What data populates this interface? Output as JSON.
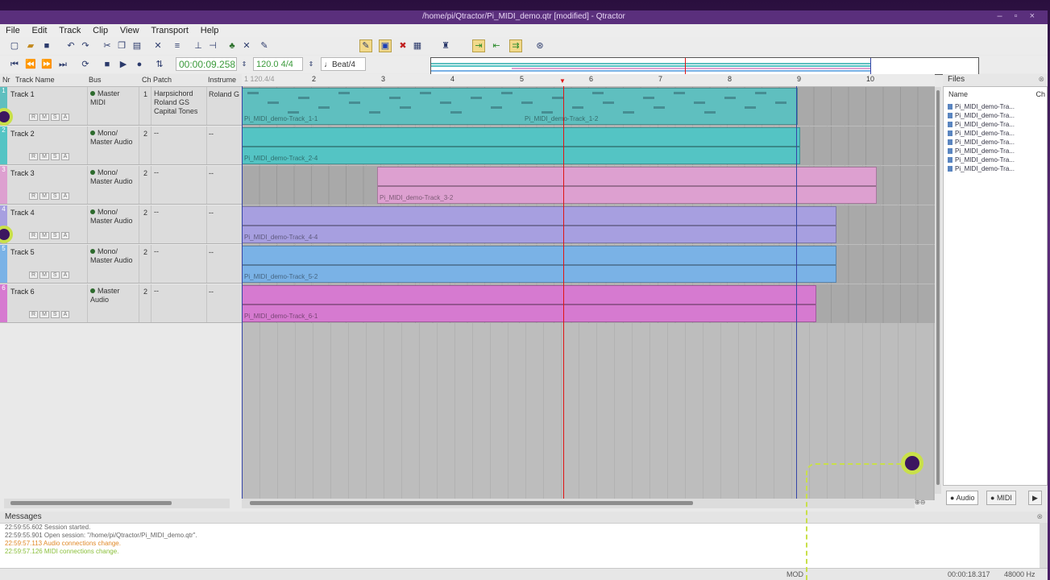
{
  "window": {
    "title": "/home/pi/Qtractor/Pi_MIDI_demo.qtr [modified] - Qtractor",
    "controls": "– ▫ ×"
  },
  "menu": [
    "File",
    "Edit",
    "Track",
    "Clip",
    "View",
    "Transport",
    "Help"
  ],
  "transport": {
    "time": "00:00:09.258",
    "tempo": "120.0 4/4",
    "snap": "♩Beat/4"
  },
  "track_headers": {
    "nr": "Nr",
    "name": "Track Name",
    "bus": "Bus",
    "ch": "Ch",
    "patch": "Patch",
    "instrument": "Instrume"
  },
  "tracks": [
    {
      "nr": "1",
      "name": "Track 1",
      "bus": "Master MIDI",
      "ch": "1",
      "patch": "Harpsichord Roland GS Capital Tones",
      "inst": "Roland G",
      "color": "#5fbfbf"
    },
    {
      "nr": "2",
      "name": "Track 2",
      "bus": "Mono/ Master Audio",
      "ch": "2",
      "patch": "--",
      "inst": "--",
      "color": "#54c4c4"
    },
    {
      "nr": "3",
      "name": "Track 3",
      "bus": "Mono/ Master Audio",
      "ch": "2",
      "patch": "--",
      "inst": "--",
      "color": "#dda0d0"
    },
    {
      "nr": "4",
      "name": "Track 4",
      "bus": "Mono/ Master Audio",
      "ch": "2",
      "patch": "--",
      "inst": "--",
      "color": "#a79fe0"
    },
    {
      "nr": "5",
      "name": "Track 5",
      "bus": "Mono/ Master Audio",
      "ch": "2",
      "patch": "--",
      "inst": "--",
      "color": "#7ab2e6"
    },
    {
      "nr": "6",
      "name": "Track 6",
      "bus": "Master Audio",
      "ch": "2",
      "patch": "--",
      "inst": "--",
      "color": "#d67ad0"
    }
  ],
  "track_buttons": [
    "R",
    "M",
    "S",
    "A"
  ],
  "ruler": {
    "start": "1 120.4/4",
    "marks": [
      "2",
      "3",
      "4",
      "5",
      "6",
      "7",
      "8",
      "9",
      "10"
    ]
  },
  "clips": [
    {
      "label": "Pi_MIDI_demo-Track_1-1",
      "label2": "Pi_MIDI_demo-Track_1-2"
    },
    {
      "label": "Pi_MIDI_demo-Track_2-4"
    },
    {
      "label": "Pi_MIDI_demo-Track_3-2"
    },
    {
      "label": "Pi_MIDI_demo-Track_4-4"
    },
    {
      "label": "Pi_MIDI_demo-Track_5-2"
    },
    {
      "label": "Pi_MIDI_demo-Track_6-1"
    }
  ],
  "files": {
    "title": "Files",
    "col_name": "Name",
    "col_ch": "Ch",
    "items": [
      "Pi_MIDI_demo-Tra...",
      "Pi_MIDI_demo-Tra...",
      "Pi_MIDI_demo-Tra...",
      "Pi_MIDI_demo-Tra...",
      "Pi_MIDI_demo-Tra...",
      "Pi_MIDI_demo-Tra...",
      "Pi_MIDI_demo-Tra...",
      "Pi_MIDI_demo-Tra..."
    ],
    "tab_audio": "Audio",
    "tab_midi": "MIDI"
  },
  "messages": {
    "title": "Messages",
    "lines": [
      {
        "text": "22:59:55.602 Session started.",
        "color": "#666666"
      },
      {
        "text": "22:59:55.901 Open session: \"/home/pi/Qtractor/Pi_MIDI_demo.qtr\".",
        "color": "#666666"
      },
      {
        "text": "22:59:57.113 Audio connections change.",
        "color": "#e08a2a"
      },
      {
        "text": "22:59:57.126 MIDI connections change.",
        "color": "#8abf3a"
      }
    ]
  },
  "status": {
    "mod": "MOD",
    "time": "00:00:18.317",
    "rate": "48000 Hz"
  }
}
